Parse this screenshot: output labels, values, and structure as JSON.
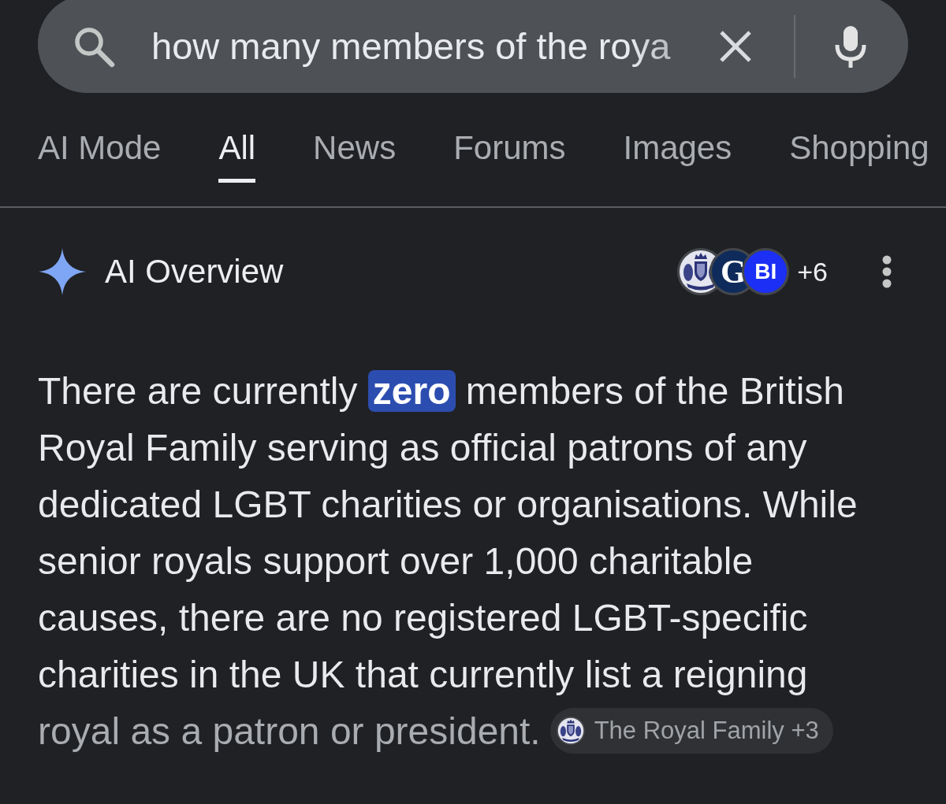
{
  "search": {
    "value": "how many members of the roya"
  },
  "tabs": [
    {
      "label": "AI Mode",
      "selected": false
    },
    {
      "label": "All",
      "selected": true
    },
    {
      "label": "News",
      "selected": false
    },
    {
      "label": "Forums",
      "selected": false
    },
    {
      "label": "Images",
      "selected": false
    },
    {
      "label": "Shopping",
      "selected": false
    }
  ],
  "ai_overview": {
    "title": "AI Overview",
    "sources": [
      {
        "kind": "crest"
      },
      {
        "kind": "letter",
        "text": "G",
        "color": "#0f2b5b"
      },
      {
        "kind": "letter",
        "text": "BI",
        "color": "#1b2ff5"
      }
    ],
    "more_sources": "+6",
    "text": "There are currently **zero** members of the British Royal Family serving as official patrons of any dedicated LGBT charities or organisations. While senior royals support over 1,000 charitable causes, there are no registered LGBT-specific charities in the UK that currently list a reigning royal as a patron or president.",
    "citation": {
      "label": "The Royal Family +3"
    }
  }
}
